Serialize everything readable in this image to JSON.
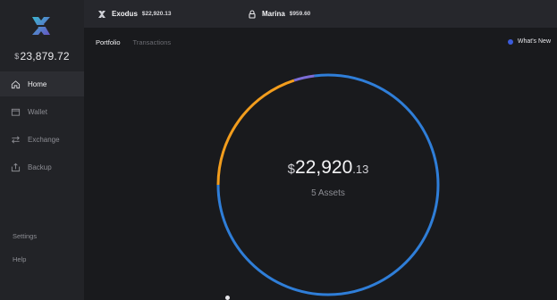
{
  "app": {
    "total_balance_currency": "$",
    "total_balance_value": "23,879.72"
  },
  "sidebar": {
    "items": [
      {
        "label": "Home",
        "icon": "home-icon",
        "active": true
      },
      {
        "label": "Wallet",
        "icon": "wallet-icon",
        "active": false
      },
      {
        "label": "Exchange",
        "icon": "exchange-icon",
        "active": false
      },
      {
        "label": "Backup",
        "icon": "backup-icon",
        "active": false
      }
    ],
    "settings_label": "Settings",
    "help_label": "Help"
  },
  "topbar": {
    "wallets": [
      {
        "name": "Exodus",
        "amount": "$22,920.13",
        "icon": "exodus-icon"
      },
      {
        "name": "Marina",
        "amount": "$959.60",
        "icon": "lock-icon"
      }
    ]
  },
  "tabs": [
    {
      "label": "Portfolio",
      "active": true
    },
    {
      "label": "Transactions",
      "active": false
    }
  ],
  "whats_new": {
    "label": "What's New",
    "dot_color": "#3b5bdb"
  },
  "portfolio": {
    "currency": "$",
    "value_int": "22,920",
    "value_dec": ".13",
    "assets_label": "5 Assets"
  },
  "chart_data": {
    "type": "pie",
    "style": "donut",
    "segments": [
      {
        "value": 0.75,
        "color": "#2f7ed8"
      },
      {
        "value": 0.2,
        "color": "#f29d1d"
      },
      {
        "value": 0.03,
        "color": "#7b6cd6"
      },
      {
        "value": 0.02,
        "color": "#2f7ed8"
      }
    ]
  }
}
